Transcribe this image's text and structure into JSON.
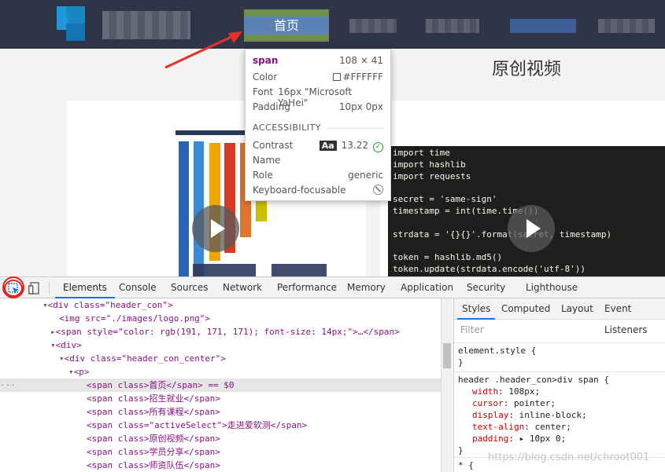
{
  "header": {
    "nav_home": "首页",
    "colors": {
      "header_bg": "#2f3547",
      "nav_active_bg": "#5b82b3",
      "highlight": "#6f8f4d"
    }
  },
  "content": {
    "section_title": "原创视频",
    "code_lines": [
      "import time",
      "import hashlib",
      "import requests",
      "",
      "secret = 'same-sign'",
      "timestamp = int(time.time())",
      "",
      "strdata = '{}{}'.format(secret, timestamp)",
      "",
      "token = hashlib.md5()",
      "token.update(strdata.encode('utf-8'))"
    ]
  },
  "tooltip": {
    "tag": "span",
    "size": "108 × 41",
    "color_label": "Color",
    "color_value": "#FFFFFF",
    "font_label": "Font",
    "font_value": "16px \"Microsoft YaHei\"",
    "padding_label": "Padding",
    "padding_value": "10px 0px",
    "accessibility_label": "ACCESSIBILITY",
    "contrast_label": "Contrast",
    "contrast_badge": "Aa",
    "contrast_value": "13.22",
    "name_label": "Name",
    "role_label": "Role",
    "role_value": "generic",
    "focusable_label": "Keyboard-focusable"
  },
  "devtools": {
    "tabs": [
      "Elements",
      "Console",
      "Sources",
      "Network",
      "Performance",
      "Memory",
      "Application",
      "Security",
      "Lighthouse"
    ],
    "dom": [
      {
        "text": "<div class=\"header_con\">"
      },
      {
        "text": "<img src=\"./images/logo.png\">"
      },
      {
        "text": "<span style=\"color: rgb(191, 171, 171); font-size: 14px;\">…</span>"
      },
      {
        "text": "<div>"
      },
      {
        "text": "<div class=\"header_con_center\">"
      },
      {
        "text": "<p>"
      },
      {
        "text": "<span class>首页</span> == $0"
      },
      {
        "text": "<span class>招生就业</span>"
      },
      {
        "text": "<span class>所有课程</span>"
      },
      {
        "text": "<span class=\"activeSelect\">走进爱软测</span>"
      },
      {
        "text": "<span class>原创视频</span>"
      },
      {
        "text": "<span class>学员分享</span>"
      },
      {
        "text": "<span class>师资队伍</span>"
      }
    ],
    "styles_tabs": [
      "Styles",
      "Computed",
      "Layout",
      "Event Listeners"
    ],
    "filter_placeholder": "Filter",
    "element_style_open": "element.style {",
    "rule_close": "}",
    "rule_selector": "header .header_con>div span {",
    "rule_props": [
      {
        "name": "width",
        "value": "108px;"
      },
      {
        "name": "cursor",
        "value": "pointer;"
      },
      {
        "name": "display",
        "value": "inline-block;"
      },
      {
        "name": "text-align",
        "value": "center;"
      },
      {
        "name": "padding",
        "value": "▸ 10px 0;"
      }
    ],
    "universal_rule": "* {"
  },
  "watermark": "https://blog.csdn.net/chroot001"
}
